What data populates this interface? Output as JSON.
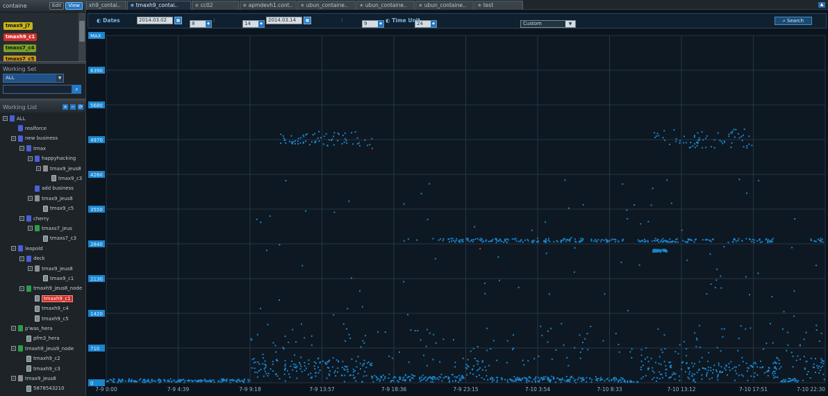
{
  "left": {
    "container_label": "containe",
    "edit_label": "Edit",
    "view_label": "View",
    "tags": [
      {
        "label": "tmax9_j7",
        "color": "#c8b41a"
      },
      {
        "label": "tmaxh9_c1",
        "color": "#d0302a"
      },
      {
        "label": "tmaxs7_c4",
        "color": "#7aa227"
      },
      {
        "label": "tmaxs7_c5",
        "color": "#c8961a"
      }
    ],
    "working_set_label": "Working Set",
    "working_set_value": "ALL",
    "working_list_label": "Working List",
    "tree": [
      {
        "label": "ALL",
        "depth": 0,
        "icon": "blue",
        "exp": "-"
      },
      {
        "label": "realforce",
        "depth": 1,
        "icon": "blue",
        "exp": ""
      },
      {
        "label": "new business",
        "depth": 1,
        "icon": "blue",
        "exp": "-"
      },
      {
        "label": "tmax",
        "depth": 2,
        "icon": "blue",
        "exp": "-"
      },
      {
        "label": "happyhacking",
        "depth": 3,
        "icon": "blue",
        "exp": "-"
      },
      {
        "label": "tmax9_jeus8",
        "depth": 4,
        "icon": "gray",
        "exp": "-"
      },
      {
        "label": "tmax9_c3",
        "depth": 5,
        "icon": "srv",
        "exp": ""
      },
      {
        "label": "add business",
        "depth": 3,
        "icon": "blue",
        "exp": ""
      },
      {
        "label": "tmax9_jeus8",
        "depth": 3,
        "icon": "gray",
        "exp": "-"
      },
      {
        "label": "tmax9_c5",
        "depth": 4,
        "icon": "srv",
        "exp": ""
      },
      {
        "label": "cherry",
        "depth": 2,
        "icon": "blue",
        "exp": "-"
      },
      {
        "label": "tmaxs7_jeus",
        "depth": 3,
        "icon": "green",
        "exp": "-"
      },
      {
        "label": "tmaxs7_c3",
        "depth": 4,
        "icon": "srv",
        "exp": ""
      },
      {
        "label": "leopold",
        "depth": 1,
        "icon": "blue",
        "exp": "-"
      },
      {
        "label": "deck",
        "depth": 2,
        "icon": "blue",
        "exp": "-"
      },
      {
        "label": "tmax9_jeus8",
        "depth": 3,
        "icon": "gray",
        "exp": "-"
      },
      {
        "label": "tmax9_c1",
        "depth": 4,
        "icon": "srv",
        "exp": ""
      },
      {
        "label": "tmaxh9_jeus8_node",
        "depth": 2,
        "icon": "green",
        "exp": "-"
      },
      {
        "label": "tmaxh9_c1",
        "depth": 3,
        "icon": "srv",
        "exp": "",
        "selected": true
      },
      {
        "label": "tmaxh9_c4",
        "depth": 3,
        "icon": "srv",
        "exp": ""
      },
      {
        "label": "tmaxh9_c5",
        "depth": 3,
        "icon": "srv",
        "exp": ""
      },
      {
        "label": "p'was_hera",
        "depth": 1,
        "icon": "green",
        "exp": "-"
      },
      {
        "label": "pfm3_hera",
        "depth": 2,
        "icon": "srv",
        "exp": ""
      },
      {
        "label": "tmaxh9_jeus9_node",
        "depth": 1,
        "icon": "green",
        "exp": "-"
      },
      {
        "label": "tmaxh9_c2",
        "depth": 2,
        "icon": "srv",
        "exp": ""
      },
      {
        "label": "tmaxh9_c3",
        "depth": 2,
        "icon": "srv",
        "exp": ""
      },
      {
        "label": "tmax9_jeus8",
        "depth": 1,
        "icon": "gray",
        "exp": "-"
      },
      {
        "label": "5878543210",
        "depth": 2,
        "icon": "srv",
        "exp": ""
      }
    ]
  },
  "tabs": [
    {
      "label": "xh9_contai..",
      "star": false,
      "active": false
    },
    {
      "label": "tmaxh9_contai..",
      "star": true,
      "active": true
    },
    {
      "label": "cc02",
      "star": true,
      "active": false
    },
    {
      "label": "apmdevh1.cont..",
      "star": true,
      "active": false
    },
    {
      "label": "ubun_containe..",
      "star": true,
      "active": false
    },
    {
      "label": "ubun_containe..",
      "star": true,
      "active": false
    },
    {
      "label": "ubun_containe..",
      "star": true,
      "active": false
    },
    {
      "label": "test",
      "star": true,
      "active": false
    }
  ],
  "filter": {
    "dates_label": "Dates",
    "from_date": "2014.03.02",
    "from_hour": "8",
    "from_min": "14",
    "to_date": "2014.03.14",
    "to_hour": "9",
    "to_min": "24",
    "time_unit_label": "Time Unit",
    "time_unit_value": "Custom",
    "search_label": "Search"
  },
  "chart_data": {
    "type": "scatter",
    "yticks": [
      "MAX",
      "6390",
      "5680",
      "4970",
      "4260",
      "3550",
      "2840",
      "2130",
      "1420",
      "710",
      "0"
    ],
    "xticks": [
      "7-9 0:00",
      "7-9 4:39",
      "7-9 9:18",
      "7-9 13:57",
      "7-9 18:36",
      "7-9 23:15",
      "7-10 3:54",
      "7-10 8:33",
      "7-10 13:12",
      "7-10 17:51",
      "7-10 22:30"
    ],
    "ylim": [
      0,
      7100
    ],
    "grid": true,
    "color": "#1a86cf",
    "outlier_color": "#e8312a"
  }
}
